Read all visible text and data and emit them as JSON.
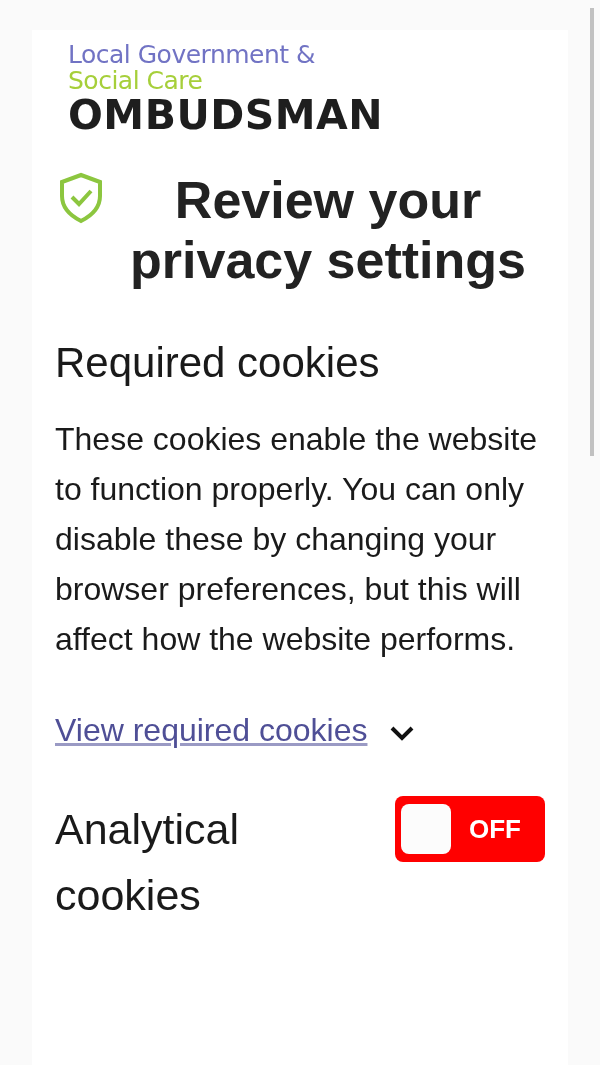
{
  "logo": {
    "line_1": "Local Government &",
    "line_2": "Social Care",
    "line_3": "OMBUDSMAN"
  },
  "title": "Review your privacy settings",
  "required": {
    "heading": "Required cookies",
    "text": "These cookies enable the website to function properly. You can only disable these by changing your browser preferences, but this will affect how the website performs.",
    "link": "View required cookies",
    "expanded": false
  },
  "analytical": {
    "heading": "Analytical cookies",
    "toggle": {
      "on": false,
      "label": "OFF"
    }
  }
}
